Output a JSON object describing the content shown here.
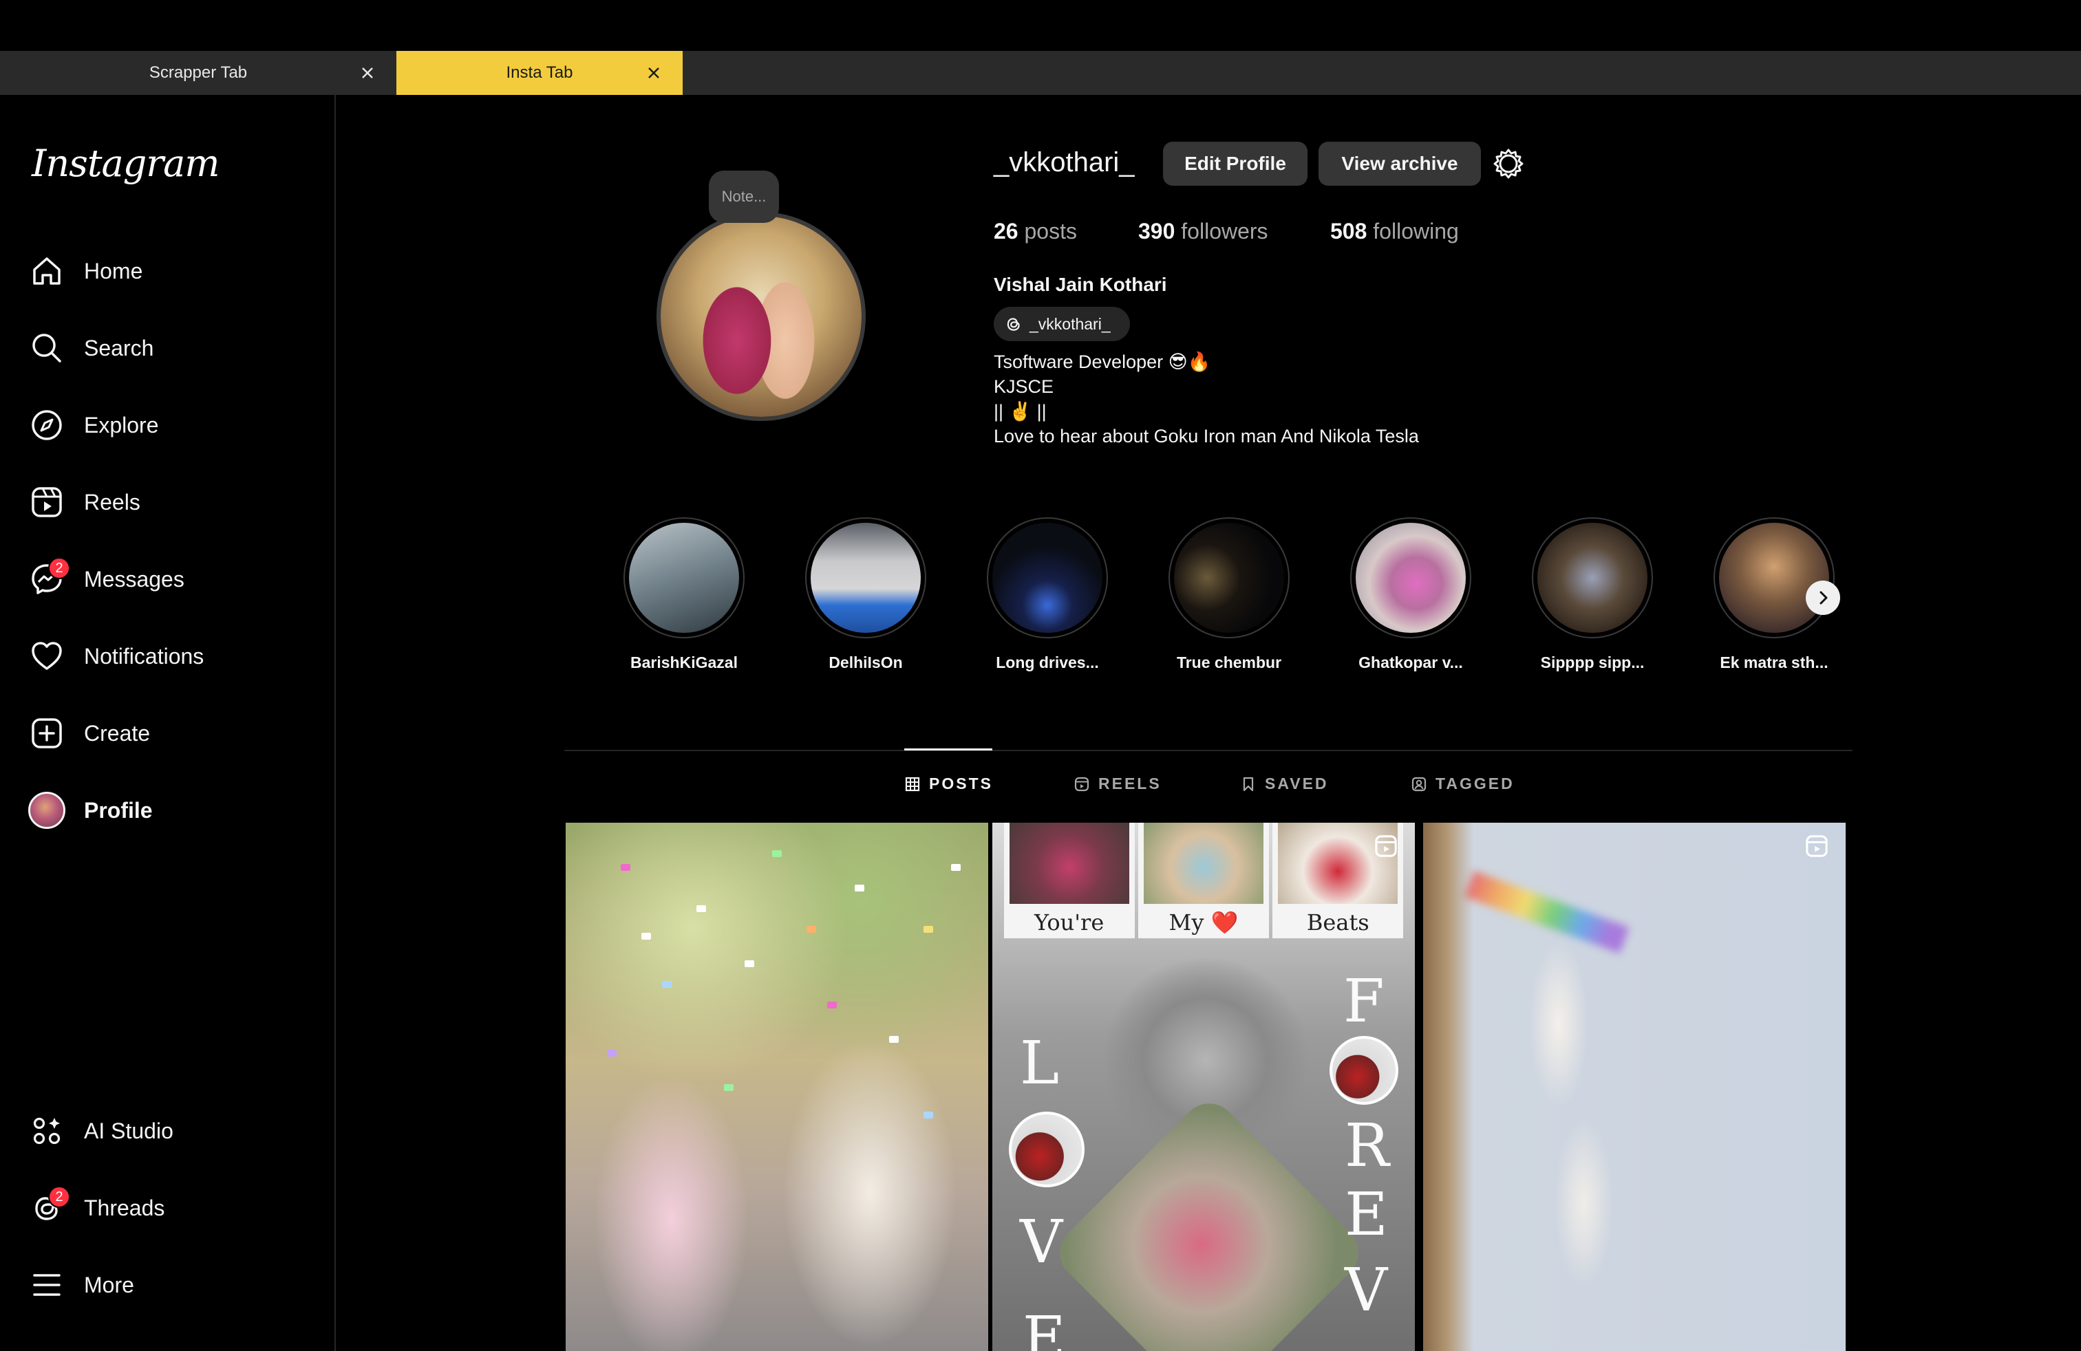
{
  "browser_tabs": [
    {
      "label": "Scrapper Tab"
    },
    {
      "label": "Insta Tab"
    }
  ],
  "sidebar": {
    "logo": "Instagram",
    "items": [
      {
        "label": "Home",
        "icon": "home-icon"
      },
      {
        "label": "Search",
        "icon": "search-icon"
      },
      {
        "label": "Explore",
        "icon": "compass-icon"
      },
      {
        "label": "Reels",
        "icon": "reels-icon"
      },
      {
        "label": "Messages",
        "icon": "messenger-icon",
        "badge": "2"
      },
      {
        "label": "Notifications",
        "icon": "heart-icon"
      },
      {
        "label": "Create",
        "icon": "plus-square-icon"
      },
      {
        "label": "Profile",
        "icon": "avatar"
      }
    ],
    "bottom_items": [
      {
        "label": "AI Studio",
        "icon": "ai-studio-icon"
      },
      {
        "label": "Threads",
        "icon": "threads-icon",
        "badge": "2"
      },
      {
        "label": "More",
        "icon": "menu-icon"
      }
    ]
  },
  "profile": {
    "note_placeholder": "Note...",
    "username": "_vkkothari_",
    "edit_button": "Edit Profile",
    "archive_button": "View archive",
    "stats": {
      "posts_count": "26",
      "posts_label": "posts",
      "followers_count": "390",
      "followers_label": "followers",
      "following_count": "508",
      "following_label": "following"
    },
    "full_name": "Vishal Jain Kothari",
    "threads_handle": "_vkkothari_",
    "bio_lines": [
      "Tsoftware Developer 😎🔥",
      "KJSCE",
      "|| ✌️ ||",
      "Love to hear about Goku Iron man And Nikola Tesla"
    ]
  },
  "highlights": [
    {
      "label": "BarishKiGazal"
    },
    {
      "label": "DelhiIsOn"
    },
    {
      "label": "Long drives..."
    },
    {
      "label": "True chembur"
    },
    {
      "label": "Ghatkopar v..."
    },
    {
      "label": "Sipppp sipp..."
    },
    {
      "label": "Ek matra sth..."
    }
  ],
  "content_tabs": [
    {
      "label": "POSTS",
      "icon": "grid-icon"
    },
    {
      "label": "REELS",
      "icon": "reels-icon"
    },
    {
      "label": "SAVED",
      "icon": "bookmark-icon"
    },
    {
      "label": "TAGGED",
      "icon": "tag-person-icon"
    }
  ],
  "post_collage": {
    "captions": [
      "You're",
      "My ❤️",
      "Beats"
    ],
    "letters_left": [
      "L",
      "V",
      "E"
    ],
    "letters_right": [
      "F",
      "R",
      "E",
      "V"
    ]
  },
  "colors": {
    "background": "#000000",
    "active_tab": "#f2cc3c",
    "badge": "#ff3040",
    "button": "#363636"
  }
}
